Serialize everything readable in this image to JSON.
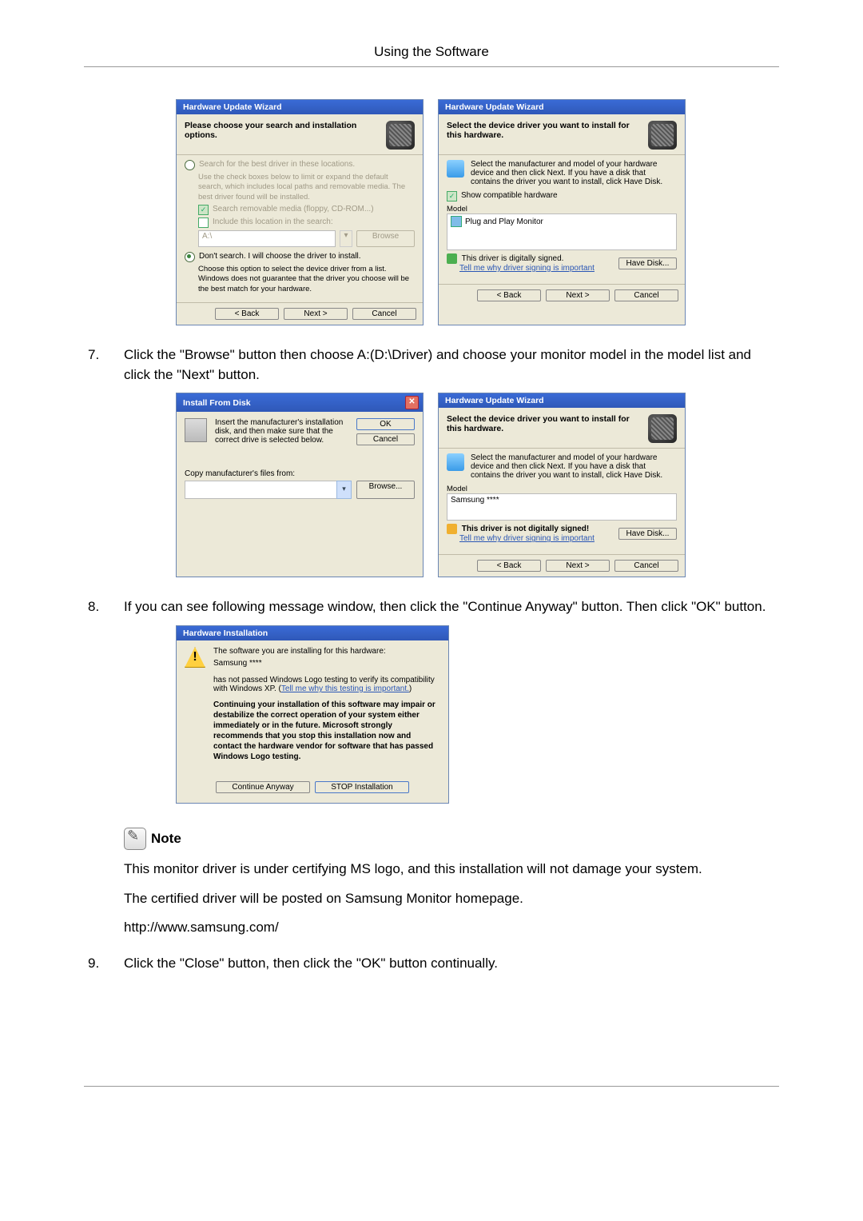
{
  "header": "Using the Software",
  "steps": {
    "s7": {
      "num": "7.",
      "text": "Click the \"Browse\" button then choose A:(D:\\Driver) and choose your monitor model in the model list and click the \"Next\" button."
    },
    "s8": {
      "num": "8.",
      "text": "If you can see following message window, then click the \"Continue Anyway\" button. Then click \"OK\" button."
    },
    "s9": {
      "num": "9.",
      "text": "Click the \"Close\" button, then click the \"OK\" button continually."
    }
  },
  "note": {
    "label": "Note",
    "p1": "This monitor driver is under certifying MS logo, and this installation will not damage your system.",
    "p2": "The certified driver will be posted on Samsung Monitor homepage.",
    "url": "http://www.samsung.com/"
  },
  "common_btns": {
    "back": "< Back",
    "next": "Next >",
    "cancel": "Cancel",
    "ok": "OK",
    "browse": "Browse",
    "browse_u": "Browse...",
    "have_disk": "Have Disk...",
    "continue": "Continue Anyway",
    "stop": "STOP Installation"
  },
  "wiz1": {
    "title": "Hardware Update Wizard",
    "heading": "Please choose your search and installation options.",
    "r1": "Search for the best driver in these locations.",
    "r1_sub": "Use the check boxes below to limit or expand the default search, which includes local paths and removable media. The best driver found will be installed.",
    "c1": "Search removable media (floppy, CD-ROM...)",
    "c2": "Include this location in the search:",
    "path": "A:\\",
    "r2": "Don't search. I will choose the driver to install.",
    "r2_sub": "Choose this option to select the device driver from a list. Windows does not guarantee that the driver you choose will be the best match for your hardware."
  },
  "wiz2": {
    "title": "Hardware Update Wizard",
    "heading": "Select the device driver you want to install for this hardware.",
    "desc": "Select the manufacturer and model of your hardware device and then click Next. If you have a disk that contains the driver you want to install, click Have Disk.",
    "show_compat": "Show compatible hardware",
    "model_label": "Model",
    "list_item": "Plug and Play Monitor",
    "signed": "This driver is digitally signed.",
    "signing_link": "Tell me why driver signing is important"
  },
  "install_from_disk": {
    "title": "Install From Disk",
    "desc": "Insert the manufacturer's installation disk, and then make sure that the correct drive is selected below.",
    "copy_label": "Copy manufacturer's files from:",
    "path": ""
  },
  "wiz4": {
    "title": "Hardware Update Wizard",
    "heading": "Select the device driver you want to install for this hardware.",
    "desc": "Select the manufacturer and model of your hardware device and then click Next. If you have a disk that contains the driver you want to install, click Have Disk.",
    "model_label": "Model",
    "list_item": "Samsung ****",
    "unsigned": "This driver is not digitally signed!",
    "signing_link": "Tell me why driver signing is important"
  },
  "hw_install": {
    "title": "Hardware Installation",
    "line1": "The software you are installing for this hardware:",
    "device": "Samsung ****",
    "line2a": "has not passed Windows Logo testing to verify its compatibility with Windows XP. (",
    "line2_link": "Tell me why this testing is important.",
    "line2b": ")",
    "bold": "Continuing your installation of this software may impair or destabilize the correct operation of your system either immediately or in the future. Microsoft strongly recommends that you stop this installation now and contact the hardware vendor for software that has passed Windows Logo testing."
  }
}
